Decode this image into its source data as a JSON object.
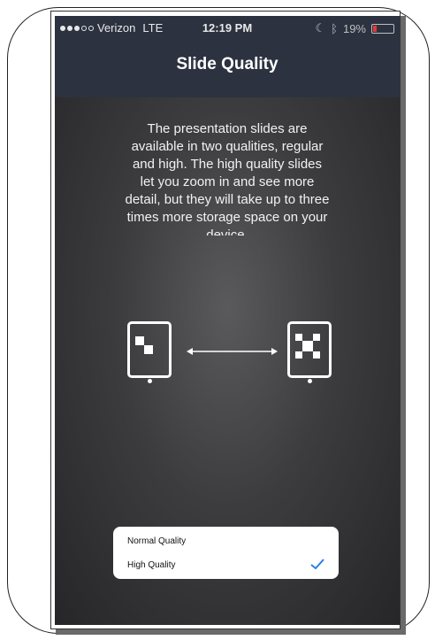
{
  "status_bar": {
    "signal_bars_filled": 3,
    "signal_bars_total": 5,
    "carrier": "Verizon",
    "network": "LTE",
    "time": "12:19 PM",
    "moon_icon": "crescent-moon-icon",
    "bluetooth_icon": "bluetooth-icon",
    "battery_percent": "19%",
    "battery_level": 0.19
  },
  "nav": {
    "title": "Slide Quality"
  },
  "description": "The presentation slides are available in two qualities, regular and high.  The high quality slides let you zoom in and see more detail, but they will take up to three times more storage space on your device.",
  "quality_options": [
    {
      "label": "Normal Quality",
      "selected": false
    },
    {
      "label": "High Quality",
      "selected": true
    }
  ],
  "colors": {
    "accent": "#2f7fe8",
    "nav_background": "#2c3240",
    "battery_low": "#e53935"
  }
}
